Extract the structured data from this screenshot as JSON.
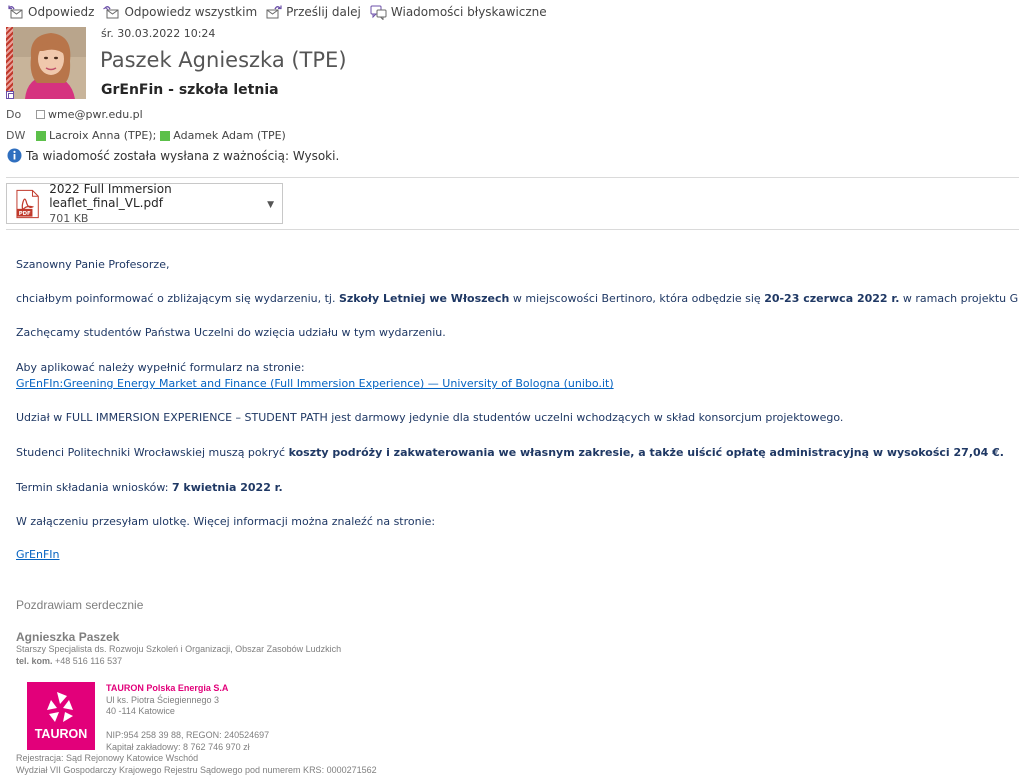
{
  "toolbar": {
    "reply": "Odpowiedz",
    "reply_all": "Odpowiedz wszystkim",
    "forward": "Prześlij dalej",
    "im": "Wiadomości błyskawiczne"
  },
  "header": {
    "date": "śr. 30.03.2022 10:24",
    "sender": "Paszek Agnieszka (TPE)",
    "subject": "GrEnFin - szkoła letnia",
    "to_label": "Do",
    "to": [
      "wme@pwr.edu.pl"
    ],
    "cc_label": "DW",
    "cc": [
      "Lacroix Anna (TPE);",
      "Adamek Adam (TPE)"
    ],
    "importance": "Ta wiadomość została wysłana z ważnością: Wysoki."
  },
  "attachment": {
    "name": "2022 Full Immersion leaflet_final_VL.pdf",
    "size": "701 KB",
    "icon": "pdf-icon",
    "icon_text": "PDF"
  },
  "body": {
    "greeting": "Szanowny Panie Profesorze,",
    "p1_a": "chciałbym poinformować o zbliżającym się wydarzeniu, tj.  ",
    "p1_b": "Szkoły Letniej we Włoszech",
    "p1_c": " w miejscowości Bertinoro, która odbędzie się ",
    "p1_d": "20-23 czerwca 2022 r.",
    "p1_e": " w ramach projektu GrEnFIn.",
    "p2": "Zachęcamy studentów Państwa Uczelni do wzięcia udziału w tym wydarzeniu.",
    "p3": "Aby aplikować należy wypełnić formularz na stronie:",
    "p3_link": "GrEnFIn:Greening Energy Market and Finance (Full Immersion Experience) — University of Bologna (unibo.it)",
    "p4": "Udział w FULL IMMERSION EXPERIENCE – STUDENT PATH jest darmowy jedynie dla studentów uczelni wchodzących w skład konsorcjum projektowego.",
    "p5_a": "Studenci Politechniki Wrocławskiej muszą pokryć ",
    "p5_b": "koszty podróży i zakwaterowania we własnym zakresie, a także uiścić opłatę administracyjną w wysokości 27,04 €.",
    "p6_a": "Termin składania wniosków: ",
    "p6_b": "7 kwietnia 2022 r.",
    "p7": "W załączeniu przesyłam ulotkę. Więcej informacji można znaleźć na stronie:",
    "p7_link": "GrEnFIn"
  },
  "signature": {
    "greeting": "Pozdrawiam serdecznie",
    "name": "Agnieszka Paszek",
    "title": "Starszy Specjalista ds. Rozwoju Szkoleń i Organizacji, Obszar Zasobów Ludzkich",
    "phone_label": "tel. kom.",
    "phone": " +48 516 116 537",
    "logo_text": "TAURON",
    "company": "TAURON Polska Energia S.A",
    "street": "Ul ks. Piotra Ściegiennego 3",
    "city": "40 -114 Katowice",
    "nip": "NIP:954 258 39 88, REGON: 240524697",
    "capital": "Kapitał zakładowy: 8 762 746 970 zł",
    "registry1": "Rejestracja: Sąd Rejonowy Katowice Wschód",
    "registry2": "Wydział VII Gospodarczy Krajowego Rejestru Sądowego pod numerem KRS: 0000271562"
  },
  "colors": {
    "accent_pink": "#e2007a",
    "body_blue": "#1f3864",
    "link_blue": "#0563c1",
    "presence_green": "#5cc04a"
  }
}
